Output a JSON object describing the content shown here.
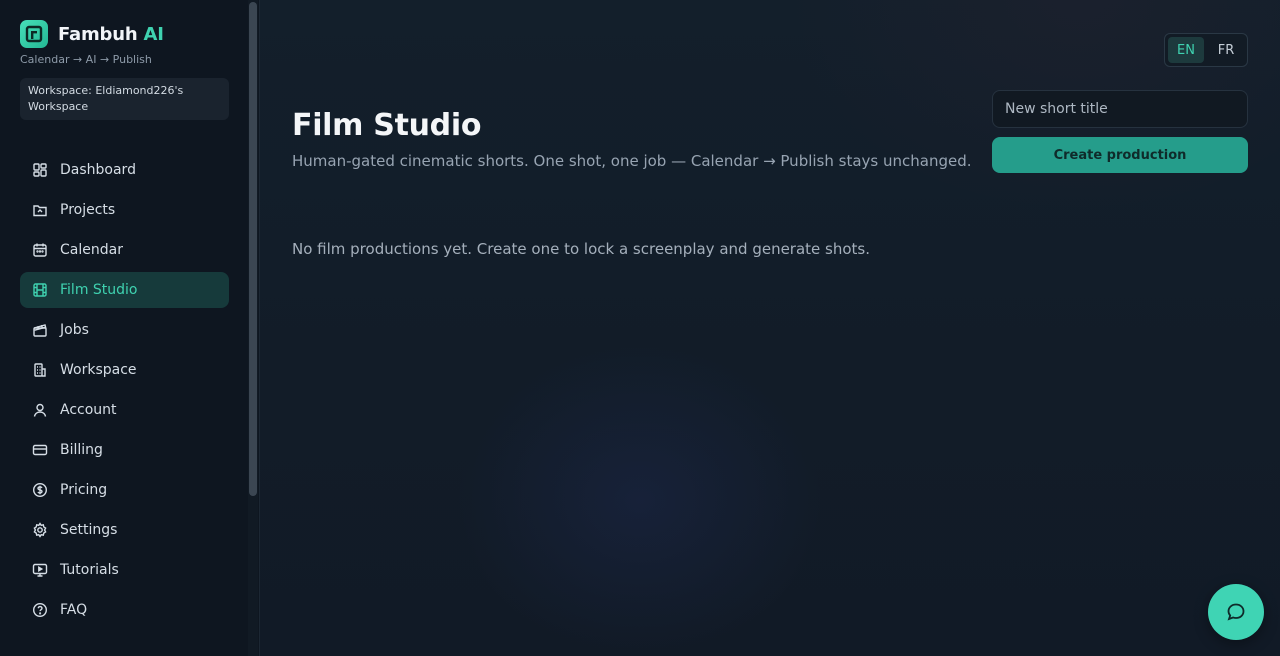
{
  "brand": {
    "name": "Fambuh",
    "accent": "AI",
    "tagline": "Calendar → AI → Publish"
  },
  "workspace": {
    "label": "Workspace: Eldiamond226's Workspace"
  },
  "nav": [
    {
      "label": "Dashboard",
      "icon": "dashboard-icon",
      "active": false
    },
    {
      "label": "Projects",
      "icon": "folder-icon",
      "active": false
    },
    {
      "label": "Calendar",
      "icon": "calendar-icon",
      "active": false
    },
    {
      "label": "Film Studio",
      "icon": "film-icon",
      "active": true
    },
    {
      "label": "Jobs",
      "icon": "clapperboard-icon",
      "active": false
    },
    {
      "label": "Workspace",
      "icon": "building-icon",
      "active": false
    },
    {
      "label": "Account",
      "icon": "user-icon",
      "active": false
    },
    {
      "label": "Billing",
      "icon": "credit-card-icon",
      "active": false
    },
    {
      "label": "Pricing",
      "icon": "dollar-circle-icon",
      "active": false
    },
    {
      "label": "Settings",
      "icon": "gear-icon",
      "active": false
    },
    {
      "label": "Tutorials",
      "icon": "play-monitor-icon",
      "active": false
    },
    {
      "label": "FAQ",
      "icon": "help-circle-icon",
      "active": false
    }
  ],
  "lang": {
    "en": "EN",
    "fr": "FR",
    "selected": "EN"
  },
  "page": {
    "title": "Film Studio",
    "subtitle": "Human-gated cinematic shorts. One shot, one job — Calendar → Publish stays unchanged.",
    "empty_state": "No film productions yet. Create one to lock a screenplay and generate shots."
  },
  "form": {
    "title_placeholder": "New short title",
    "create_label": "Create production"
  },
  "colors": {
    "accent": "#3fd2b0",
    "button": "#259d8b",
    "background": "#111a26",
    "sidebar": "#0e1620"
  },
  "chat": {
    "icon": "chat-bubble-icon"
  }
}
